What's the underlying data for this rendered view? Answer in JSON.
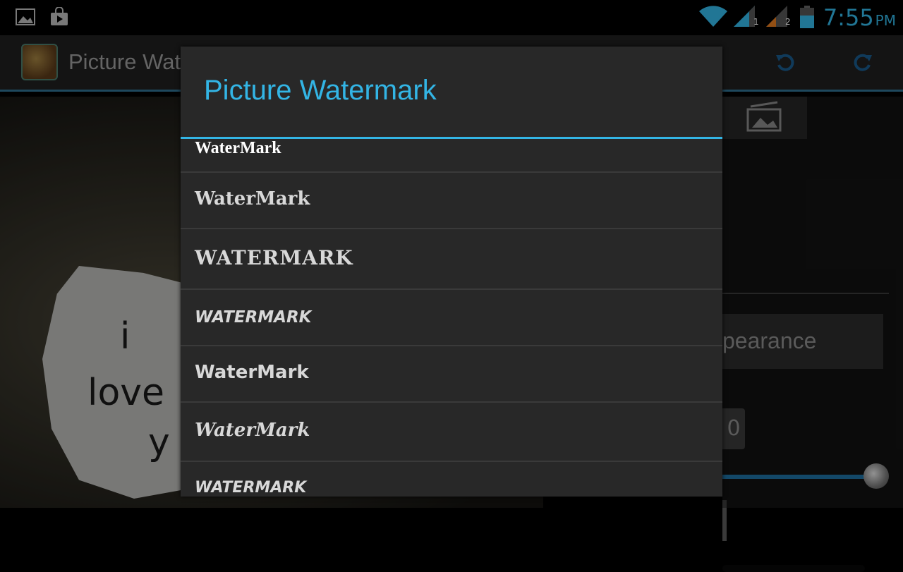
{
  "status_bar": {
    "time": "7:55",
    "ampm": "PM",
    "icons": [
      "gallery-icon",
      "store-bag-icon",
      "wifi-icon",
      "signal-sim1-icon",
      "signal-sim2-icon",
      "battery-icon"
    ],
    "sim1_label": "1",
    "sim2_label": "2",
    "accent_color": "#33b5e5"
  },
  "action_bar": {
    "title": "Picture Wat",
    "undo_icon": "undo-icon",
    "redo_icon": "redo-icon"
  },
  "background": {
    "photo_text_1": "i",
    "photo_text_2": "love",
    "photo_text_3": "y",
    "panel_appearance": "pearance",
    "panel_number": "0",
    "panel_slider_level": 1.0
  },
  "dialog": {
    "title": "Picture Watermark",
    "items": [
      {
        "label": "WaterMark"
      },
      {
        "label": "WaterMark"
      },
      {
        "label": "WATERMARK"
      },
      {
        "label": "WATERMARK"
      },
      {
        "label": "WaterMark"
      },
      {
        "label": "WaterMark"
      },
      {
        "label": "WATERMARK"
      }
    ]
  }
}
